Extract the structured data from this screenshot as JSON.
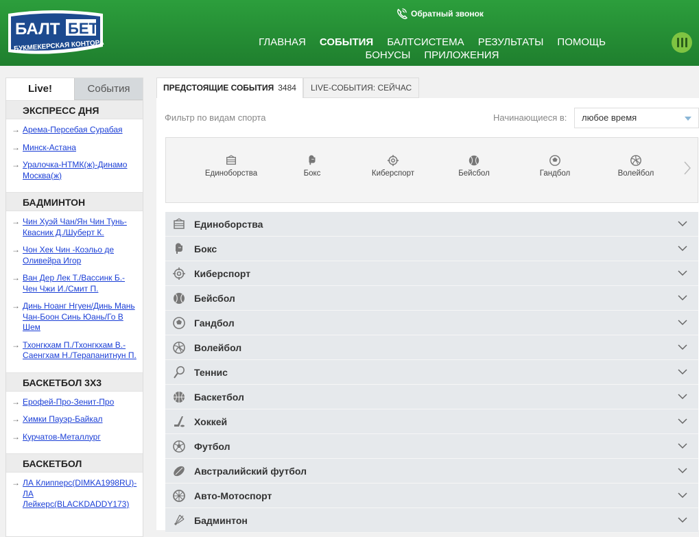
{
  "header": {
    "logo_top": "БАЛТ",
    "logo_top2": "БЕТ",
    "logo_bottom": "БУКМЕКЕРСКАЯ КОНТОРА",
    "callback": "Обратный звонок",
    "nav_row1": [
      "ГЛАВНАЯ",
      "СОБЫТИЯ",
      "БАЛТСИСТЕМА",
      "РЕЗУЛЬТАТЫ",
      "ПОМОЩЬ"
    ],
    "nav_row2": [
      "БОНУСЫ",
      "ПРИЛОЖЕНИЯ"
    ],
    "active": "СОБЫТИЯ"
  },
  "sidebar": {
    "tabs": [
      "Live!",
      "События"
    ],
    "sections": [
      {
        "title": "ЭКСПРЕСС ДНЯ",
        "items": [
          "Арема-Персебая Сурабая",
          "Минск-Астана",
          "Уралочка-НТМК(ж)-Динамо Москва(ж)"
        ]
      },
      {
        "title": "БАДМИНТОН",
        "items": [
          "Чин Хуэй Чан/Ян Чин Тунь-Квасник Д./Шуберт К.",
          "Чон Хек Чин -Коэльо де Оливейра Игор",
          "Ван Дер Лек Т./Вассинк Б.-Чен Чжи И./Смит П.",
          "Динь Ноанг Нгуен/Динь Мань Чан-Боон Синь Юань/Го В Шем",
          "Тхонгкхам П./Тхонгкхам В.-Саенгхам Н./Терапанитнун П."
        ]
      },
      {
        "title": "БАСКЕТБОЛ 3Х3",
        "items": [
          "Ерофей-Про-Зенит-Про",
          "Химки Пауэр-Байкал",
          "Курчатов-Металлург"
        ]
      },
      {
        "title": "БАСКЕТБОЛ",
        "items": [
          "ЛА Клипперс(DIMKA1998RU)-ЛА Лейкерс(BLACKDADDY173)"
        ]
      }
    ]
  },
  "main": {
    "tab_upcoming": "ПРЕДСТОЯЩИЕ СОБЫТИЯ",
    "tab_upcoming_count": "3484",
    "tab_live": "LIVE-СОБЫТИЯ: СЕЙЧАС",
    "filter_label": "Фильтр по видам спорта",
    "start_label": "Начинающиеся в:",
    "start_value": "любое время",
    "carousel": [
      {
        "label": "Единоборства",
        "icon": "ring-icon"
      },
      {
        "label": "Бокс",
        "icon": "boxing-glove-icon"
      },
      {
        "label": "Киберспорт",
        "icon": "crosshair-icon"
      },
      {
        "label": "Бейсбол",
        "icon": "baseball-icon"
      },
      {
        "label": "Гандбол",
        "icon": "handball-icon"
      },
      {
        "label": "Волейбол",
        "icon": "volleyball-icon"
      }
    ],
    "sports": [
      {
        "label": "Единоборства",
        "icon": "ring-icon"
      },
      {
        "label": "Бокс",
        "icon": "boxing-glove-icon"
      },
      {
        "label": "Киберспорт",
        "icon": "crosshair-icon"
      },
      {
        "label": "Бейсбол",
        "icon": "baseball-icon"
      },
      {
        "label": "Гандбол",
        "icon": "handball-icon"
      },
      {
        "label": "Волейбол",
        "icon": "volleyball-icon"
      },
      {
        "label": "Теннис",
        "icon": "tennis-racket-icon"
      },
      {
        "label": "Баскетбол",
        "icon": "basketball-icon"
      },
      {
        "label": "Хоккей",
        "icon": "hockey-stick-icon"
      },
      {
        "label": "Футбол",
        "icon": "football-icon"
      },
      {
        "label": "Австралийский футбол",
        "icon": "aussie-ball-icon"
      },
      {
        "label": "Авто-Мотоспорт",
        "icon": "wheel-icon"
      },
      {
        "label": "Бадминтон",
        "icon": "shuttlecock-icon"
      }
    ]
  },
  "colors": {
    "header": "#259134",
    "accent": "#7fc442",
    "link": "#1a3ed6",
    "row": "#e6e9ec"
  }
}
